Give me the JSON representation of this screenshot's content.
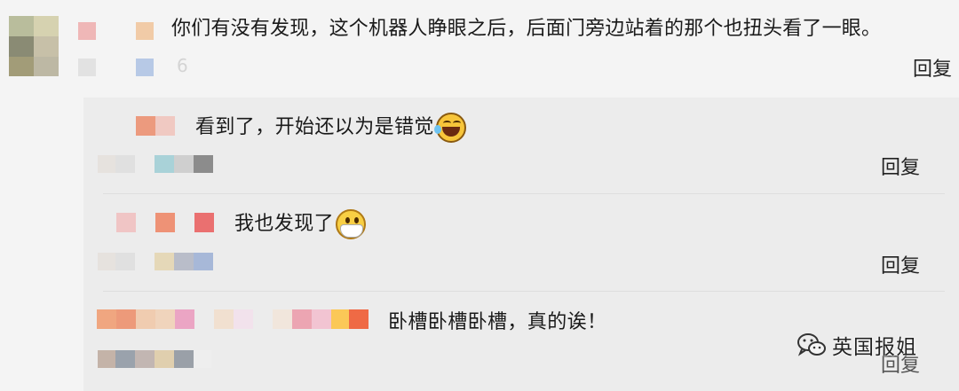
{
  "main_comment": {
    "text": "你们有没有发现，这个机器人睁眼之后，后面门旁边站着的那个也扭头看了一眼。",
    "meta_partial": "6",
    "reply_label": "回复"
  },
  "replies": [
    {
      "text": "看到了，开始还以为是错觉",
      "emoji": "laugh-cry-emoji",
      "reply_label": "回复"
    },
    {
      "text": "我也发现了",
      "emoji": "mask-face-emoji",
      "reply_label": "回复"
    },
    {
      "text": "卧槽卧槽卧槽，真的诶！",
      "reply_label": "回复"
    }
  ],
  "watermark": {
    "text": "英国报姐",
    "icon": "wechat-icon"
  },
  "colors": {
    "background": "#f4f4f4",
    "reply_panel": "#ececec",
    "text": "#1a1a1a"
  }
}
